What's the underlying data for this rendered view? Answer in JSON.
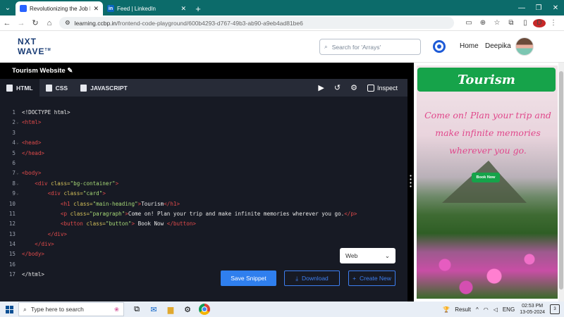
{
  "browser": {
    "tabs": [
      {
        "title": "Revolutionizing the Job Market",
        "favicon_color": "#2962ff",
        "active": true
      },
      {
        "title": "Feed | LinkedIn",
        "favicon_text": "in",
        "favicon_color": "#0a66c2",
        "active": false
      }
    ],
    "url_host": "learning.ccbp.in",
    "url_path": "/frontend-code-playground/600b4293-d767-49b3-ab90-a9eb4ad81be6",
    "profile_letter": "D"
  },
  "site": {
    "logo_line1": "NXT",
    "logo_line2": "WAVE",
    "logo_tm": "TM",
    "search_placeholder": "Search for 'Arrays'",
    "nav_home": "Home",
    "nav_user": "Deepika"
  },
  "editor": {
    "project_title": "Tourism Website",
    "tabs": [
      {
        "label": "HTML",
        "active": true
      },
      {
        "label": "CSS",
        "active": false
      },
      {
        "label": "JAVASCRIPT",
        "active": false
      }
    ],
    "inspect_label": "Inspect",
    "code_lines": [
      {
        "n": "1",
        "fold": false,
        "indent": "",
        "parts": [
          [
            "txt",
            "<!DOCTYPE html>"
          ]
        ]
      },
      {
        "n": "2",
        "fold": true,
        "indent": "",
        "parts": [
          [
            "tag",
            "<html>"
          ]
        ]
      },
      {
        "n": "3",
        "fold": false,
        "indent": "",
        "parts": []
      },
      {
        "n": "4",
        "fold": true,
        "indent": "",
        "parts": [
          [
            "tag",
            "<head>"
          ]
        ]
      },
      {
        "n": "5",
        "fold": false,
        "indent": "",
        "parts": [
          [
            "tag",
            "</head>"
          ]
        ]
      },
      {
        "n": "6",
        "fold": false,
        "indent": "",
        "parts": []
      },
      {
        "n": "7",
        "fold": true,
        "indent": "",
        "parts": [
          [
            "tag",
            "<body>"
          ]
        ]
      },
      {
        "n": "8",
        "fold": true,
        "indent": "    ",
        "parts": [
          [
            "tag",
            "<div "
          ],
          [
            "attr",
            "class="
          ],
          [
            "str",
            "\"bg-container\""
          ],
          [
            "tag",
            ">"
          ]
        ]
      },
      {
        "n": "9",
        "fold": true,
        "indent": "        ",
        "parts": [
          [
            "tag",
            "<div "
          ],
          [
            "attr",
            "class="
          ],
          [
            "str",
            "\"card\""
          ],
          [
            "tag",
            ">"
          ]
        ]
      },
      {
        "n": "10",
        "fold": false,
        "indent": "            ",
        "parts": [
          [
            "tag",
            "<h1 "
          ],
          [
            "attr",
            "class="
          ],
          [
            "str",
            "\"main-heading\""
          ],
          [
            "tag",
            ">"
          ],
          [
            "txt",
            "Tourism"
          ],
          [
            "tag",
            "</h1>"
          ]
        ]
      },
      {
        "n": "11",
        "fold": false,
        "indent": "            ",
        "parts": [
          [
            "tag",
            "<p "
          ],
          [
            "attr",
            "class="
          ],
          [
            "str",
            "\"paragraph\""
          ],
          [
            "tag",
            ">"
          ],
          [
            "txt",
            "Come on! Plan your trip and make infinite memories wherever you go."
          ],
          [
            "tag",
            "</p>"
          ]
        ]
      },
      {
        "n": "12",
        "fold": false,
        "indent": "            ",
        "parts": [
          [
            "tag",
            "<button "
          ],
          [
            "attr",
            "class="
          ],
          [
            "str",
            "\"button\""
          ],
          [
            "tag",
            ">"
          ],
          [
            "txt",
            " Book Now "
          ],
          [
            "tag",
            "</button>"
          ]
        ]
      },
      {
        "n": "13",
        "fold": false,
        "indent": "        ",
        "parts": [
          [
            "tag",
            "</div>"
          ]
        ]
      },
      {
        "n": "14",
        "fold": false,
        "indent": "    ",
        "parts": [
          [
            "tag",
            "</div>"
          ]
        ]
      },
      {
        "n": "15",
        "fold": false,
        "indent": "",
        "parts": [
          [
            "tag",
            "</body>"
          ]
        ]
      },
      {
        "n": "16",
        "fold": false,
        "indent": "",
        "parts": []
      },
      {
        "n": "17",
        "fold": false,
        "indent": "",
        "parts": [
          [
            "txt",
            "</html>"
          ]
        ]
      }
    ],
    "view_select": "Web",
    "save_label": "Save Snippet",
    "download_label": "Download",
    "create_label": "Create New"
  },
  "preview": {
    "heading": "Tourism",
    "paragraph": "Come on! Plan your trip and make infinite memories wherever you go.",
    "button": "Book Now"
  },
  "taskbar": {
    "search_placeholder": "Type here to search",
    "tray_result": "Result",
    "language": "ENG",
    "time": "02:53 PM",
    "date": "13-05-2024",
    "notification_count": "3"
  },
  "colors": {
    "brand_blue": "#2f7fee",
    "tab_strip": "#0c6b6a",
    "tourism_green": "#16a34a",
    "tourism_pink": "#e0478b"
  }
}
